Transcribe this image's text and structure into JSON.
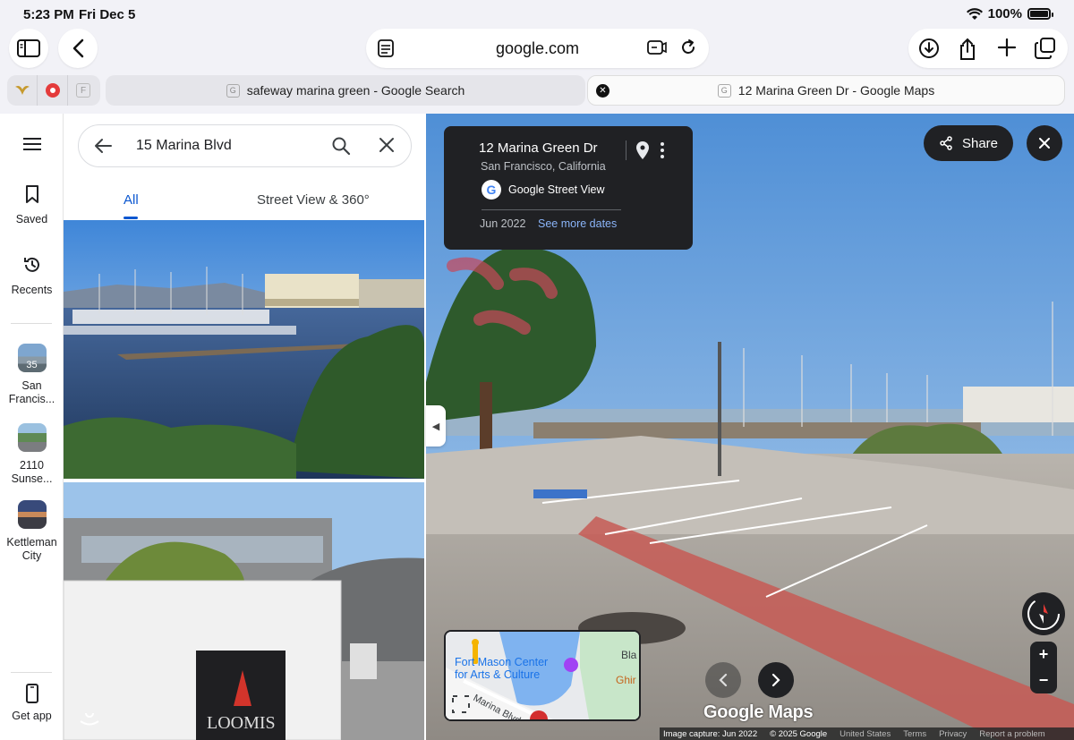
{
  "status_bar": {
    "time": "5:23 PM",
    "date": "Fri Dec 5",
    "battery": "100%"
  },
  "browser": {
    "url": "google.com",
    "tabs": [
      {
        "title": "safeway marina green - Google Search",
        "favicon": "G",
        "active": false
      },
      {
        "title": "12 Marina Green Dr - Google Maps",
        "favicon": "G",
        "active": true
      }
    ],
    "pinned_tab_favicon_letter": "F"
  },
  "rail": {
    "menu_icon": "hamburger-icon",
    "saved": "Saved",
    "recents": "Recents",
    "recent_places": [
      {
        "label": "San Francis...",
        "badge": "35"
      },
      {
        "label": "2110 Sunse..."
      },
      {
        "label": "Kettleman City"
      }
    ],
    "get_app": "Get app"
  },
  "search": {
    "query": "15 Marina Blvd",
    "tabs": [
      "All",
      "Street View & 360°"
    ]
  },
  "info_card": {
    "title": "12 Marina Green Dr",
    "subtitle": "San Francisco, California",
    "source": "Google Street View",
    "date": "Jun 2022",
    "more_dates": "See more dates"
  },
  "street_view": {
    "share": "Share",
    "watermark": "Google Maps",
    "minimap_labels": [
      "Fort Mason Center for Arts & Culture",
      "Marina Blvd",
      "Bla",
      "Ghir"
    ],
    "footer": [
      "Image capture: Jun 2022",
      "© 2025 Google",
      "United States",
      "Terms",
      "Privacy",
      "Report a problem"
    ]
  },
  "colors": {
    "accent": "#0b57d0",
    "dark_chip": "#202124",
    "sky": "#6fa3dc"
  }
}
